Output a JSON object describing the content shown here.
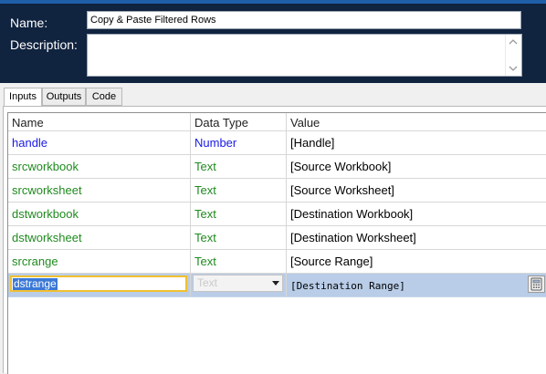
{
  "header": {
    "name_label": "Name:",
    "description_label": "Description:",
    "name_value": "Copy & Paste Filtered Rows",
    "description_value": ""
  },
  "tabs": [
    {
      "label": "Inputs",
      "active": true
    },
    {
      "label": "Outputs",
      "active": false
    },
    {
      "label": "Code",
      "active": false
    }
  ],
  "table": {
    "columns": [
      "Name",
      "Data Type",
      "Value"
    ],
    "rows": [
      {
        "name": "handle",
        "type": "Number",
        "value": "[Handle]",
        "color": "blue"
      },
      {
        "name": "srcworkbook",
        "type": "Text",
        "value": "[Source Workbook]",
        "color": "green"
      },
      {
        "name": "srcworksheet",
        "type": "Text",
        "value": "[Source Worksheet]",
        "color": "green"
      },
      {
        "name": "dstworkbook",
        "type": "Text",
        "value": "[Destination Workbook]",
        "color": "green"
      },
      {
        "name": "dstworksheet",
        "type": "Text",
        "value": "[Destination Worksheet]",
        "color": "green"
      },
      {
        "name": "srcrange",
        "type": "Text",
        "value": "[Source Range]",
        "color": "green"
      }
    ],
    "editing_row": {
      "name": "dstrange",
      "type": "Text",
      "value": "[Destination Range]"
    }
  },
  "colors": {
    "header_bg": "#10233f",
    "accent_blue": "#1f5fa8",
    "number_type": "#1a1ae6",
    "text_type": "#1f8a1f",
    "selected_row": "#b9cde8",
    "edit_border": "#f0c030"
  },
  "icons": {
    "calculator": "calculator-icon",
    "scroll_up": "chevron-up-icon",
    "scroll_down": "chevron-down-icon",
    "dropdown": "chevron-down-icon"
  }
}
